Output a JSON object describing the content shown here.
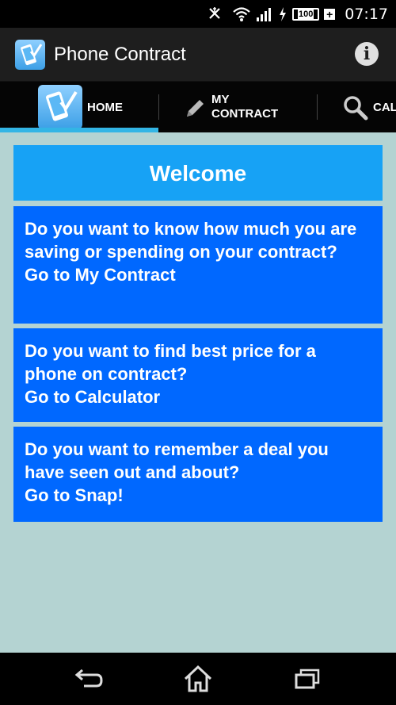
{
  "status_bar": {
    "time": "07:17",
    "battery": "100",
    "battery_plus": "+",
    "icons": [
      "nfc-icon",
      "wifi-icon",
      "signal-icon",
      "charging-icon",
      "battery-icon"
    ]
  },
  "action_bar": {
    "title": "Phone Contract",
    "info_label": "i"
  },
  "tabs": [
    {
      "label": "HOME",
      "icon": "phone-check-icon",
      "selected": true
    },
    {
      "label_line1": "MY",
      "label_line2": "CONTRACT",
      "icon": "pencil-icon"
    },
    {
      "label": "CAL",
      "icon": "search-icon"
    }
  ],
  "content": {
    "welcome": "Welcome",
    "cards": [
      {
        "question": "Do you want to know how much you are saving or spending on your contract?",
        "link": "Go to My Contract"
      },
      {
        "question": "Do you want to find best price for a phone on contract?",
        "link": "Go to Calculator"
      },
      {
        "question": "Do you want to remember a deal you have seen out and about?",
        "link": "Go to Snap!"
      }
    ]
  },
  "colors": {
    "background": "#b4d3d2",
    "welcome": "#17a2f5",
    "card": "#0068ff",
    "tab_indicator": "#33b5e5"
  },
  "nav_bar": [
    "back-icon",
    "home-icon",
    "recent-apps-icon"
  ]
}
